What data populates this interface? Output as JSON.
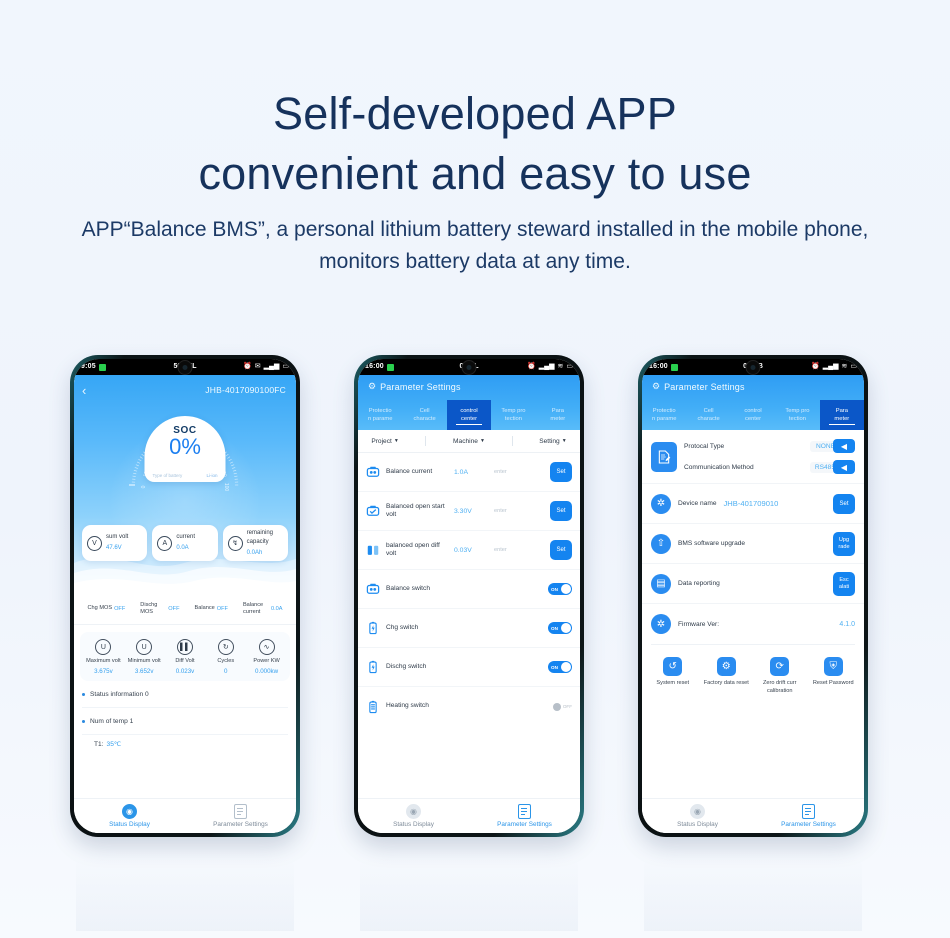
{
  "headline": {
    "line1": "Self-developed APP",
    "line2": "convenient and easy to use"
  },
  "subtitle": "APP“Balance BMS”, a personal lithium battery steward installed in the mobile phone, monitors battery data at any time.",
  "colors": {
    "background": "#f1f6fd",
    "headline": "#16325c",
    "accent_blue": "#1484f0",
    "value_blue": "#4fb0f2",
    "tab_active": "#0b57c8"
  },
  "phone1": {
    "statusbar": {
      "time": "9:05",
      "center": "56.4KL",
      "icons": [
        "alarm-icon",
        "mail-icon",
        "signal-icon",
        "battery-icon"
      ]
    },
    "nav": {
      "back": "‹",
      "device_id": "JHB-4017090100FC"
    },
    "gauge": {
      "label": "SOC",
      "value": "0%",
      "sub_left": "Type of battery",
      "sub_right": "Li-ion",
      "ticks": [
        "0",
        "10",
        "20",
        "30",
        "40",
        "50",
        "60",
        "70",
        "80",
        "90",
        "100"
      ]
    },
    "cards": [
      {
        "icon": "volt-ring-icon",
        "label": "sum volt",
        "value": "47.6V"
      },
      {
        "icon": "current-ring-icon",
        "label": "current",
        "value": "0.0A"
      },
      {
        "icon": "capacity-ring-icon",
        "label": "remaining capacity",
        "value": "0.0Ah"
      }
    ],
    "mos": [
      {
        "label": "Chg MOS",
        "value": "OFF"
      },
      {
        "label": "Dischg MOS",
        "value": "OFF"
      },
      {
        "label": "Balance",
        "value": "OFF"
      },
      {
        "label": "Balance current",
        "value": "0.0A"
      }
    ],
    "metrics": [
      {
        "icon": "max-volt-icon",
        "label": "Maximum volt",
        "value": "3.675v"
      },
      {
        "icon": "min-volt-icon",
        "label": "Minimum volt",
        "value": "3.652v"
      },
      {
        "icon": "diff-volt-icon",
        "label": "Diff Volt",
        "value": "0.023v"
      },
      {
        "icon": "cycles-icon",
        "label": "Cycles",
        "value": "0"
      },
      {
        "icon": "power-icon",
        "label": "Power KW",
        "value": "0.000kw"
      }
    ],
    "status_info": "Status information 0",
    "num_of_temp": "Num of temp 1",
    "temp_label": "T1:",
    "temp_value": "35℃",
    "bottom_nav": [
      {
        "label": "Status Display",
        "icon": "gauge-icon",
        "active": true
      },
      {
        "label": "Parameter Settings",
        "icon": "settings-doc-icon",
        "active": false
      }
    ]
  },
  "phone2": {
    "statusbar": {
      "time": "16:00",
      "center": "0.3KL"
    },
    "header_title": "Parameter Settings",
    "tabs": [
      {
        "l1": "Protectio",
        "l2": "n parame",
        "active": false
      },
      {
        "l1": "Cell",
        "l2": "characte",
        "active": false
      },
      {
        "l1": "control",
        "l2": "center",
        "active": true
      },
      {
        "l1": "Temp pro",
        "l2": "tection",
        "active": false
      },
      {
        "l1": "Para",
        "l2": "meter",
        "active": false
      }
    ],
    "filters": [
      "Project",
      "Machine",
      "Setting"
    ],
    "rows": [
      {
        "icon": "balance-current-icon",
        "label": "Balance current",
        "value": "1.0A",
        "placeholder": "enter",
        "button": "Set",
        "type": "value"
      },
      {
        "icon": "balanced-open-start-icon",
        "label": "Balanced open start volt",
        "value": "3.30V",
        "placeholder": "enter",
        "button": "Set",
        "type": "value"
      },
      {
        "icon": "balanced-open-diff-icon",
        "label": "balanced open diff volt",
        "value": "0.03V",
        "placeholder": "enter",
        "button": "Set",
        "type": "value"
      },
      {
        "icon": "balance-switch-icon",
        "label": "Balance switch",
        "toggle": "ON",
        "type": "toggle"
      },
      {
        "icon": "chg-switch-icon",
        "label": "Chg switch",
        "toggle": "ON",
        "type": "toggle"
      },
      {
        "icon": "dischg-switch-icon",
        "label": "Dischg switch",
        "toggle": "ON",
        "type": "toggle"
      },
      {
        "icon": "heating-switch-icon",
        "label": "Heating switch",
        "toggle": "OFF",
        "type": "toggle"
      }
    ],
    "bottom_nav": [
      {
        "label": "Status Display",
        "icon": "gauge-icon",
        "active": false
      },
      {
        "label": "Parameter Settings",
        "icon": "settings-doc-icon",
        "active": true
      }
    ]
  },
  "phone3": {
    "statusbar": {
      "time": "16:00",
      "center": "0.2KB"
    },
    "header_title": "Parameter Settings",
    "tabs": [
      {
        "l1": "Protectio",
        "l2": "n parame",
        "active": false
      },
      {
        "l1": "Cell",
        "l2": "characte",
        "active": false
      },
      {
        "l1": "control",
        "l2": "center",
        "active": false
      },
      {
        "l1": "Temp pro",
        "l2": "tection",
        "active": false
      },
      {
        "l1": "Para",
        "l2": "meter",
        "active": true
      }
    ],
    "protocol": {
      "icon": "document-pen-icon",
      "line1_label": "Protocal Type",
      "line1_value": "NONE",
      "line2_label": "Communication Method",
      "line2_value": "RS485"
    },
    "device": {
      "icon": "bluetooth-icon",
      "label": "Device name",
      "value": "JHB-401709010",
      "button": "Set"
    },
    "upgrade": {
      "icon": "upload-circle-icon",
      "label": "BMS software upgrade",
      "button_l1": "Upg",
      "button_l2": "rade"
    },
    "reporting": {
      "icon": "data-report-icon",
      "label": "Data reporting",
      "button_l1": "Esc",
      "button_l2": "alati"
    },
    "firmware": {
      "icon": "bluetooth-icon",
      "label": "Firmware Ver:",
      "value": "4.1.0"
    },
    "actions": [
      {
        "icon": "system-reset-icon",
        "label": "System reset"
      },
      {
        "icon": "factory-reset-icon",
        "label": "Factory data reset"
      },
      {
        "icon": "zero-drift-icon",
        "label": "Zero drift curr calibration"
      },
      {
        "icon": "reset-password-icon",
        "label": "Reset Password"
      }
    ],
    "bottom_nav": [
      {
        "label": "Status Display",
        "icon": "gauge-icon",
        "active": false
      },
      {
        "label": "Parameter Settings",
        "icon": "settings-doc-icon",
        "active": true
      }
    ]
  }
}
